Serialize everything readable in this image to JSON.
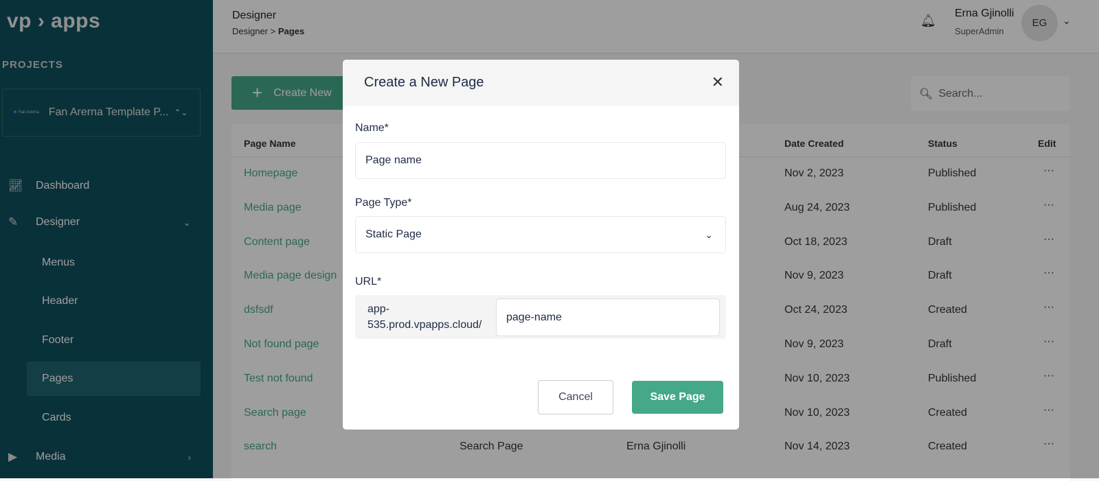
{
  "sidebar": {
    "logo": "vp › apps",
    "projects_label": "PROJECTS",
    "project_logo_text": "Fan Arerna",
    "project_name": "Fan Arerna Template P...",
    "nav": [
      {
        "label": "Dashboard",
        "icon": "chart-line-icon"
      },
      {
        "label": "Designer",
        "icon": "pencil-ruler-icon"
      },
      {
        "label": "Media",
        "icon": "play-icon"
      }
    ],
    "designer_sub": [
      "Menus",
      "Header",
      "Footer",
      "Pages",
      "Cards"
    ],
    "active_sub": "Pages"
  },
  "topbar": {
    "title": "Designer",
    "breadcrumb_root": "Designer",
    "breadcrumb_sep": ">",
    "breadcrumb_current": "Pages",
    "user_name": "Erna Gjinolli",
    "user_role": "SuperAdmin",
    "avatar_initials": "EG"
  },
  "toolbar": {
    "create_label": "Create New",
    "search_placeholder": "Search..."
  },
  "table": {
    "headers": {
      "name": "Page Name",
      "date": "Date Created",
      "status": "Status",
      "edit": "Edit"
    },
    "rows": [
      {
        "name": "Homepage",
        "date": "Nov 2, 2023",
        "status": "Published"
      },
      {
        "name": "Media page",
        "date": "Aug 24, 2023",
        "status": "Published"
      },
      {
        "name": "Content page",
        "date": "Oct 18, 2023",
        "status": "Draft"
      },
      {
        "name": "Media page design",
        "date": "Nov 9, 2023",
        "status": "Draft"
      },
      {
        "name": "dsfsdf",
        "date": "Oct 24, 2023",
        "status": "Created"
      },
      {
        "name": "Not found page",
        "date": "Nov 9, 2023",
        "status": "Draft"
      },
      {
        "name": "Test not found",
        "date": "Nov 10, 2023",
        "status": "Published"
      },
      {
        "name": "Search page",
        "date": "Nov 10, 2023",
        "status": "Created"
      },
      {
        "name": "search",
        "type": "Search Page",
        "created_by": "Erna Gjinolli",
        "date": "Nov 14, 2023",
        "status": "Created"
      }
    ],
    "edit_label": "···"
  },
  "modal": {
    "title": "Create a New Page",
    "name_label": "Name*",
    "name_placeholder": "Page name",
    "type_label": "Page Type*",
    "type_value": "Static Page",
    "url_label": "URL*",
    "url_prefix": "app-535.prod.vpapps.cloud/",
    "url_value": "page-name",
    "cancel_label": "Cancel",
    "save_label": "Save Page"
  },
  "colors": {
    "accent": "#44a889",
    "sidebar": "#0f4f5c"
  }
}
